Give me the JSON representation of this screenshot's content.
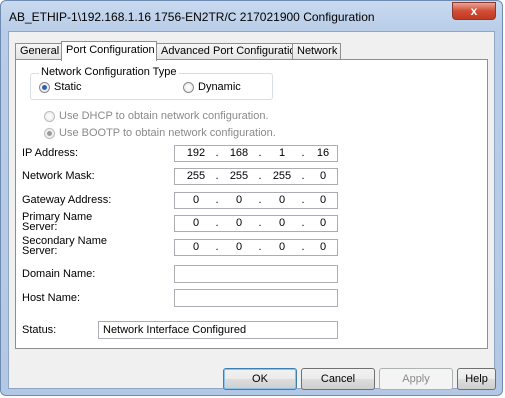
{
  "window": {
    "title": "AB_ETHIP-1\\192.168.1.16 1756-EN2TR/C 217021900 Configuration",
    "close_label": "x"
  },
  "tabs": [
    {
      "label": "General"
    },
    {
      "label": "Port Configuration"
    },
    {
      "label": "Advanced Port Configuration"
    },
    {
      "label": "Network"
    }
  ],
  "network_config": {
    "group_label": "Network Configuration Type",
    "static_label": "Static",
    "dynamic_label": "Dynamic",
    "selected": "Static",
    "dhcp_label": "Use DHCP to obtain network configuration.",
    "bootp_label": "Use BOOTP to obtain network configuration."
  },
  "fields": {
    "ip_address": {
      "label": "IP Address:",
      "octets": [
        "192",
        "168",
        "1",
        "16"
      ]
    },
    "network_mask": {
      "label": "Network Mask:",
      "octets": [
        "255",
        "255",
        "255",
        "0"
      ]
    },
    "gateway": {
      "label": "Gateway Address:",
      "octets": [
        "0",
        "0",
        "0",
        "0"
      ]
    },
    "primary_dns": {
      "label_line1": "Primary Name",
      "label_line2": "Server:",
      "octets": [
        "0",
        "0",
        "0",
        "0"
      ]
    },
    "secondary_dns": {
      "label_line1": "Secondary Name",
      "label_line2": "Server:",
      "octets": [
        "0",
        "0",
        "0",
        "0"
      ]
    },
    "domain_name": {
      "label": "Domain Name:",
      "value": ""
    },
    "host_name": {
      "label": "Host Name:",
      "value": ""
    },
    "status": {
      "label": "Status:",
      "value": "Network Interface Configured"
    }
  },
  "buttons": {
    "ok": "OK",
    "cancel": "Cancel",
    "apply": "Apply",
    "help": "Help"
  }
}
